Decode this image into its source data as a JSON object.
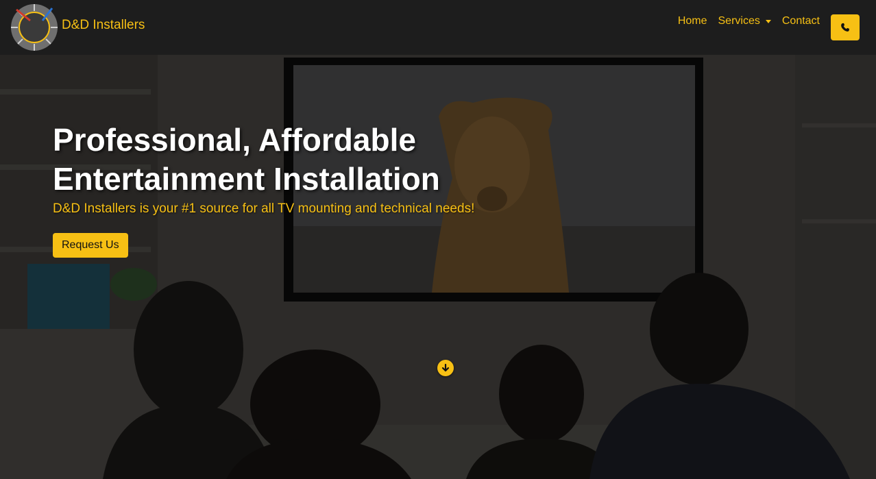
{
  "brand": {
    "name": "D&D Installers",
    "logo_text": "D&D Installers"
  },
  "nav": {
    "items": [
      {
        "label": "Home"
      },
      {
        "label": "Services"
      },
      {
        "label": "Contact"
      }
    ],
    "phone_icon": "phone-icon"
  },
  "hero": {
    "title_line1": "Professional, Affordable",
    "title_line2": "Entertainment Installation",
    "subtitle": "D&D Installers is your #1 source for all TV mounting and technical needs!",
    "cta_label": "Request Us",
    "scroll_icon": "arrow-down-circle-icon"
  },
  "colors": {
    "accent": "#f7c014",
    "navbar": "#1d1d1d",
    "text": "#ffffff"
  }
}
